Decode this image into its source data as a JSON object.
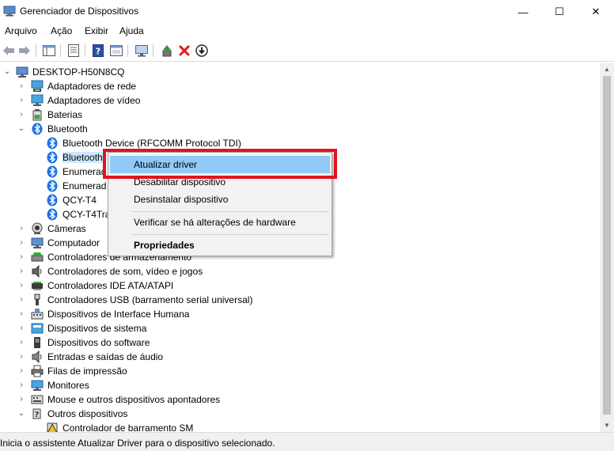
{
  "window": {
    "title": "Gerenciador de Dispositivos",
    "minimize": "—",
    "maximize": "☐",
    "close": "✕"
  },
  "menu": [
    "Arquivo",
    "Ação",
    "Exibir",
    "Ajuda"
  ],
  "tree": {
    "root": "DESKTOP-H50N8CQ",
    "items": [
      "Adaptadores de rede",
      "Adaptadores de vídeo",
      "Baterias",
      "Bluetooth",
      "Bluetooth Device (RFCOMM Protocol TDI)",
      "Bluetooth",
      "Enumerad",
      "Enumerad",
      "QCY-T4",
      "QCY-T4Tra",
      "Câmeras",
      "Computador",
      "Controladores de armazenamento",
      "Controladores de som, vídeo e jogos",
      "Controladores IDE ATA/ATAPI",
      "Controladores USB (barramento serial universal)",
      "Dispositivos de Interface Humana",
      "Dispositivos de sistema",
      "Dispositivos do software",
      "Entradas e saídas de áudio",
      "Filas de impressão",
      "Monitores",
      "Mouse e outros dispositivos apontadores",
      "Outros dispositivos",
      "Controlador de barramento SM"
    ]
  },
  "context_menu": {
    "update_driver": "Atualizar driver",
    "disable_device": "Desabilitar dispositivo",
    "uninstall_device": "Desinstalar dispositivo",
    "scan_hardware": "Verificar se há alterações de hardware",
    "properties": "Propriedades"
  },
  "status": "Inicia o assistente Atualizar Driver para o dispositivo selecionado.",
  "colors": {
    "highlight_border": "#e0141e",
    "menu_hover": "#91c9f7",
    "bluetooth_blue": "#1a73e8",
    "remove_red": "#e01818",
    "enable_green": "#2e9b2e"
  }
}
